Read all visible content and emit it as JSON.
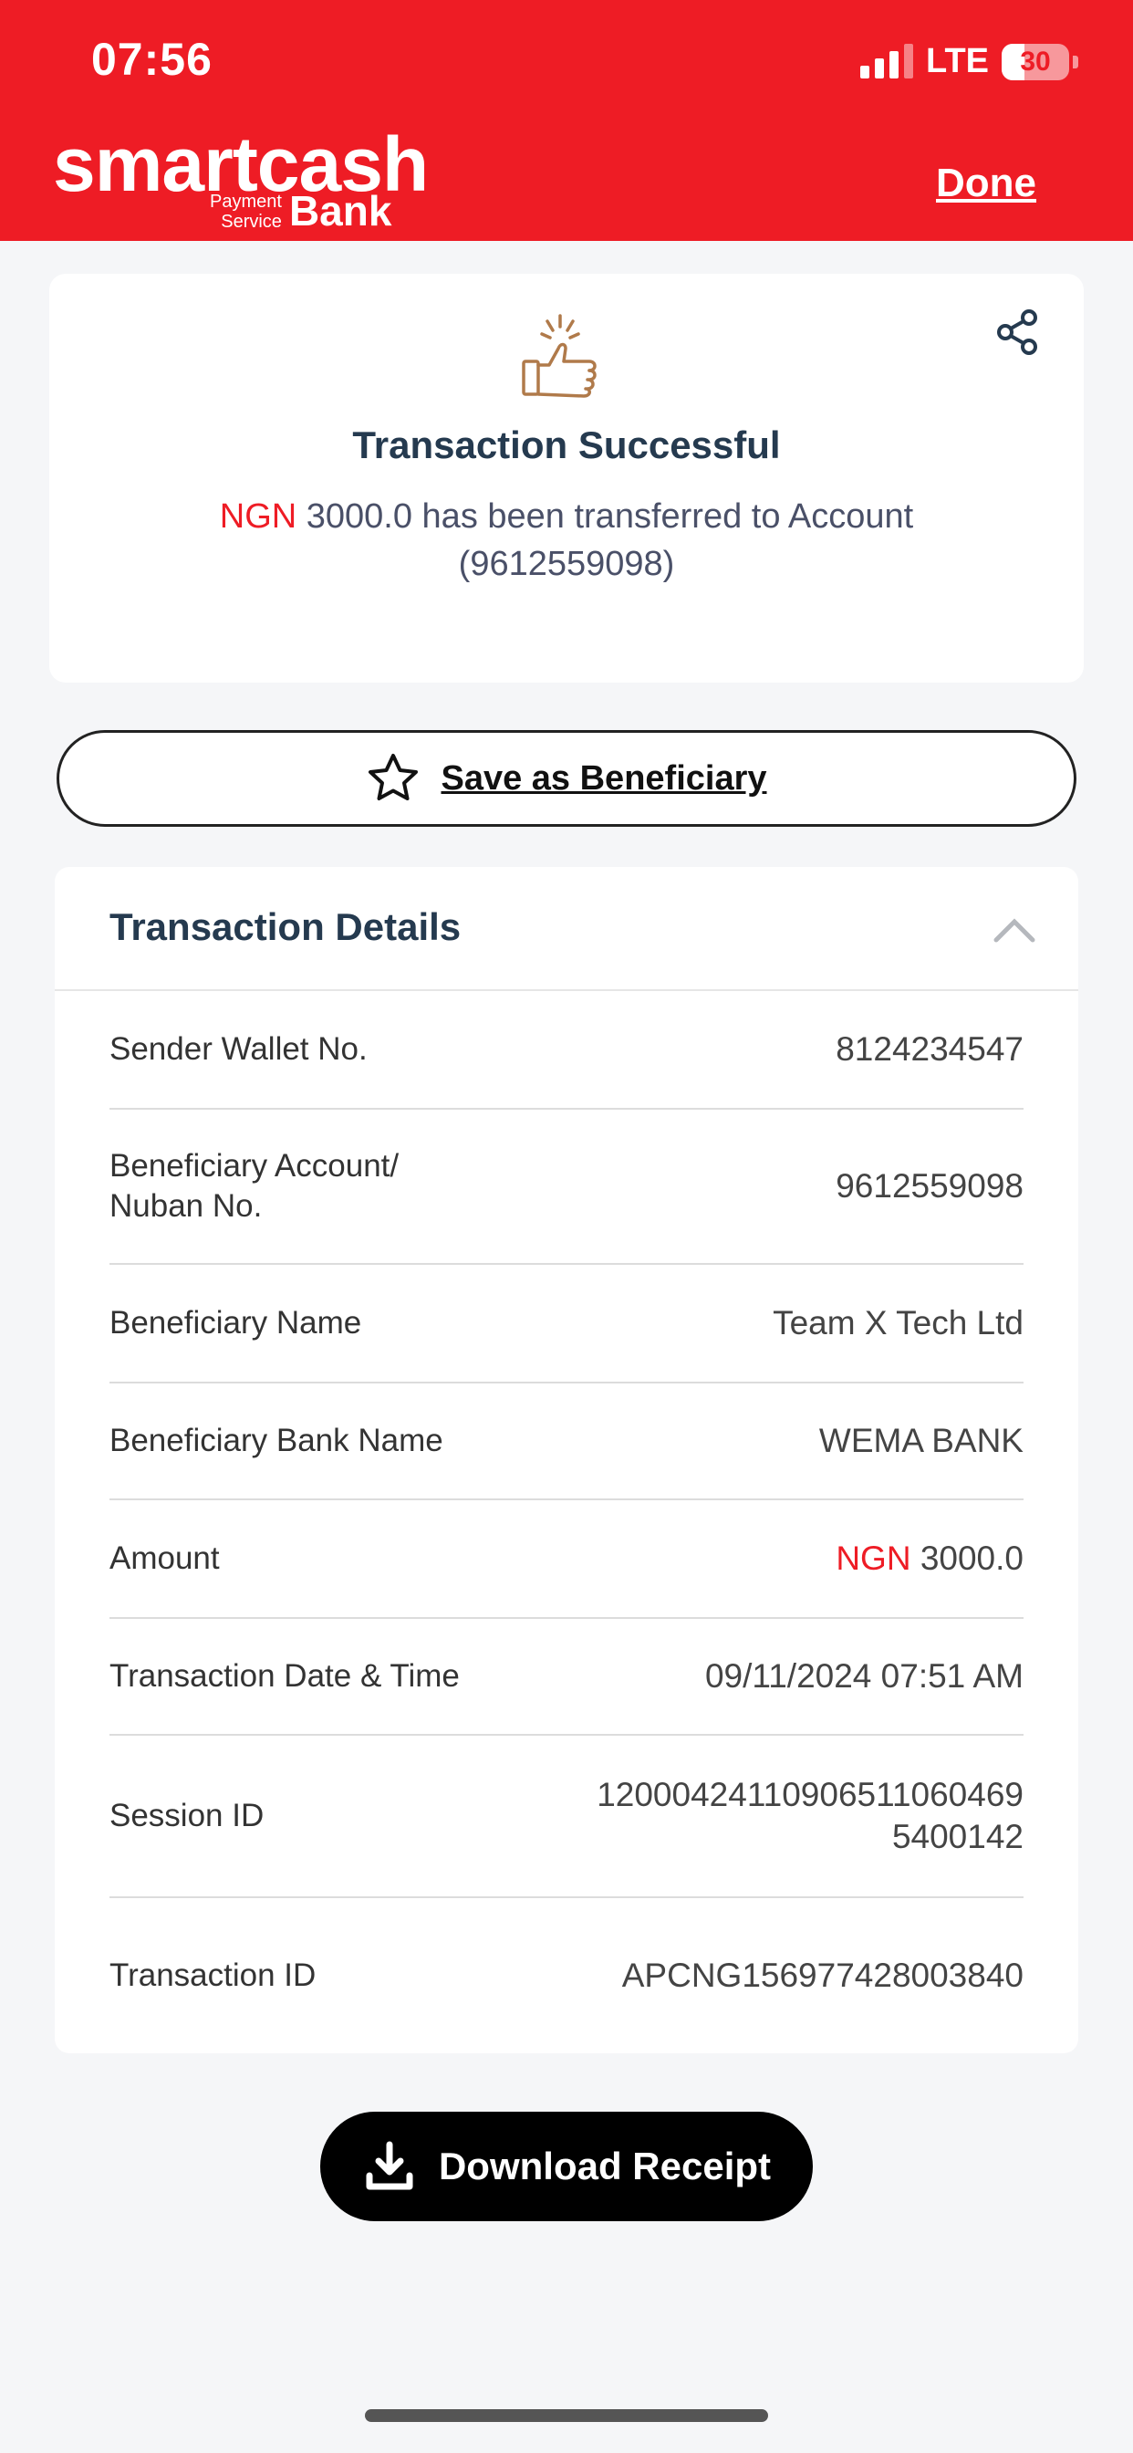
{
  "status_bar": {
    "time": "07:56",
    "network": "LTE",
    "battery": "30"
  },
  "header": {
    "logo_main": "smartcash",
    "logo_payment": "Payment",
    "logo_service": "Service",
    "logo_bank": "Bank",
    "done_label": "Done"
  },
  "success": {
    "icon": "thumbs-up-icon",
    "title": "Transaction Successful",
    "currency": "NGN",
    "message": "3000.0 has been transferred to Account (9612559098)"
  },
  "beneficiary_button": {
    "label": "Save as Beneficiary",
    "icon": "star-icon"
  },
  "details": {
    "title": "Transaction Details",
    "rows": [
      {
        "label": "Sender Wallet No.",
        "value": "8124234547"
      },
      {
        "label": "Beneficiary Account/ Nuban No.",
        "value": "9612559098"
      },
      {
        "label": "Beneficiary Name",
        "value": "Team X Tech Ltd"
      },
      {
        "label": "Beneficiary Bank Name",
        "value": "WEMA BANK"
      },
      {
        "label": "Amount",
        "currency": "NGN",
        "value": "3000.0"
      },
      {
        "label": "Transaction Date & Time",
        "value": "09/11/2024 07:51 AM"
      },
      {
        "label": "Session ID",
        "value": "120004241109065110604695400142"
      },
      {
        "label": "Transaction ID",
        "value": "APCNG156977428003840"
      }
    ]
  },
  "download_button": {
    "label": "Download Receipt",
    "icon": "download-icon"
  },
  "colors": {
    "brand_red": "#ee1c25",
    "heading": "#253a4f"
  }
}
